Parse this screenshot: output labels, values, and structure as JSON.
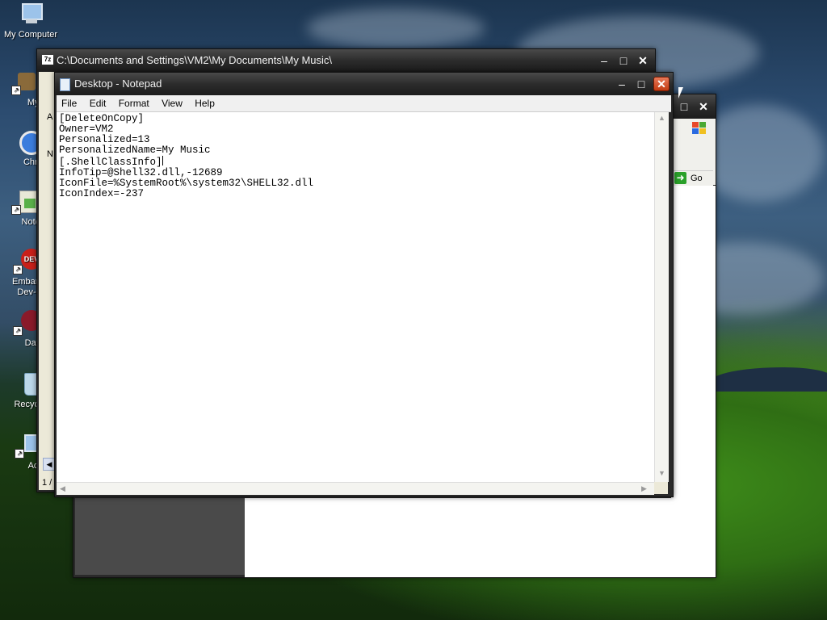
{
  "desktop": {
    "icons": [
      {
        "label": "My Computer"
      },
      {
        "label": "MyPa"
      },
      {
        "label": "Chrom"
      },
      {
        "label": "Notepa"
      },
      {
        "label": "Embarca Dev-C"
      },
      {
        "label": "DataWa"
      },
      {
        "label": "Recycle"
      },
      {
        "label": "Ac"
      }
    ]
  },
  "explorer2": {
    "go_label": "Go"
  },
  "explorer7z": {
    "app_icon_text": "7z",
    "title": "C:\\Documents and Settings\\VM2\\My Documents\\My Music\\",
    "status_text": "1 /",
    "left_letters": [
      "A",
      "N"
    ]
  },
  "notepad": {
    "title": "Desktop - Notepad",
    "menu": [
      "File",
      "Edit",
      "Format",
      "View",
      "Help"
    ],
    "content_before_caret": "[DeleteOnCopy]\nOwner=VM2\nPersonalized=13\nPersonalizedName=My Music\n[.ShellClassInfo]",
    "content_after_caret": "\nInfoTip=@Shell32.dll,-12689\nIconFile=%SystemRoot%\\system32\\SHELL32.dll\nIconIndex=-237"
  },
  "colors": {
    "titlebar_dark": "#2c2c2c",
    "close_red": "#c23b12",
    "go_green": "#2aa02a"
  }
}
